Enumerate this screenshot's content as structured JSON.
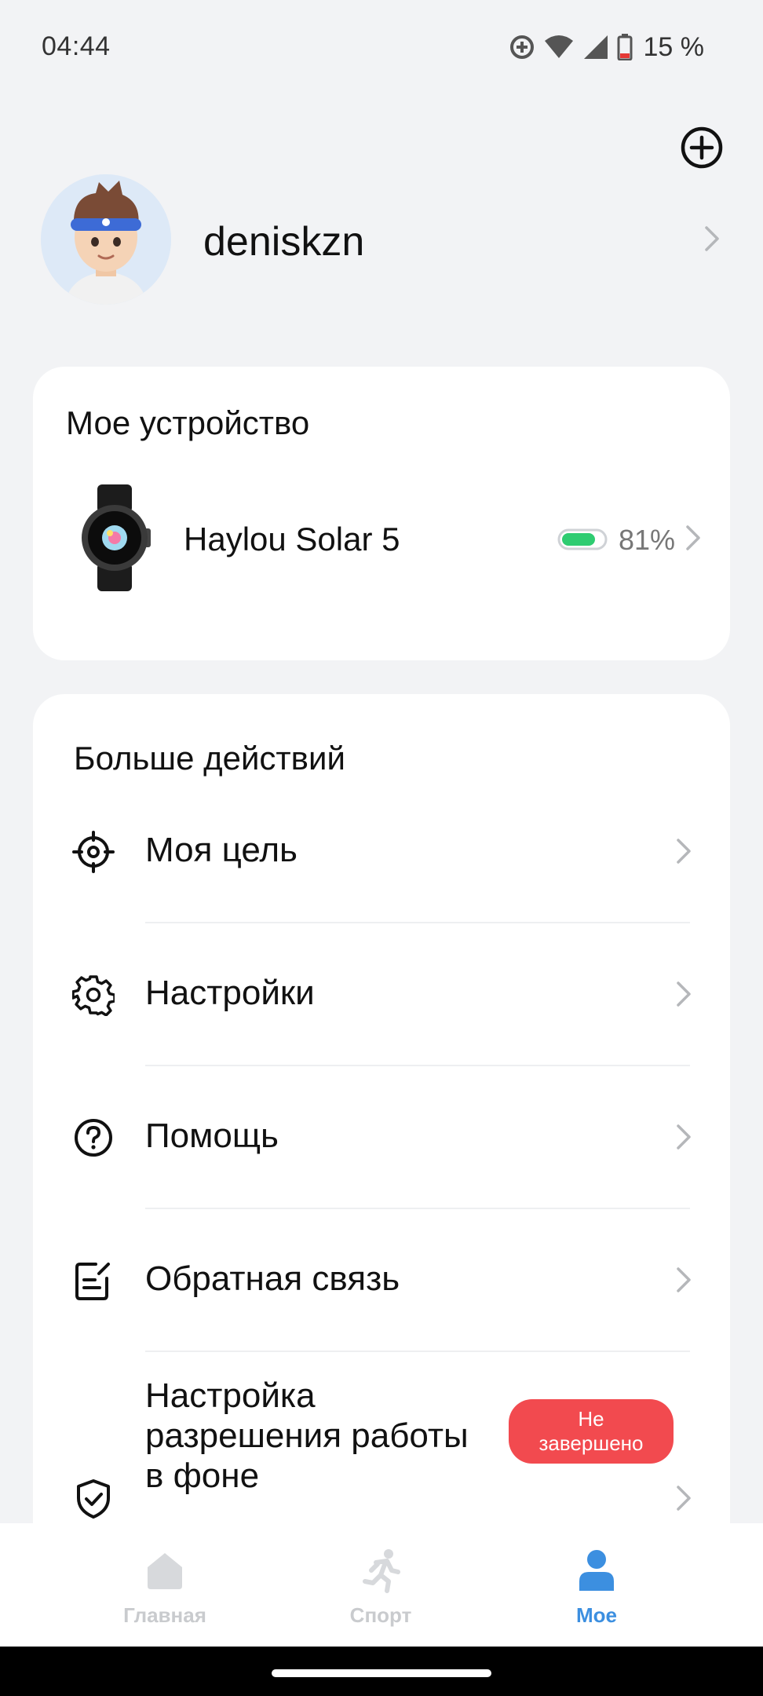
{
  "status_bar": {
    "time": "04:44",
    "battery": "15 %",
    "icons": [
      "sync-icon",
      "wifi-icon",
      "signal-icon",
      "battery-icon"
    ]
  },
  "header": {
    "add_icon": "plus-circle-icon"
  },
  "profile": {
    "username": "deniskzn"
  },
  "device_card": {
    "title": "Мое устройство",
    "device": {
      "name": "Haylou Solar 5",
      "battery_percent": "81%",
      "battery_level": 0.81,
      "battery_color": "#2ecc71"
    }
  },
  "actions_card": {
    "title": "Больше действий",
    "items": [
      {
        "label": "Моя цель",
        "icon": "target-icon"
      },
      {
        "label": "Настройки",
        "icon": "gear-icon"
      },
      {
        "label": "Помощь",
        "icon": "question-circle-icon"
      },
      {
        "label": "Обратная связь",
        "icon": "feedback-icon"
      },
      {
        "label_line1": "Настройка",
        "label_line2": "разрешения работы",
        "label_line3": "в фоне",
        "icon": "shield-check-icon",
        "status_line1": "Не",
        "status_line2": "завершено",
        "status_color": "#f24a4f"
      }
    ]
  },
  "bottom_nav": {
    "items": [
      {
        "label": "Главная",
        "icon": "home-icon",
        "active": false
      },
      {
        "label": "Спорт",
        "icon": "running-icon",
        "active": false
      },
      {
        "label": "Мое",
        "icon": "person-icon",
        "active": true
      }
    ],
    "active_color": "#3c8fe0"
  }
}
